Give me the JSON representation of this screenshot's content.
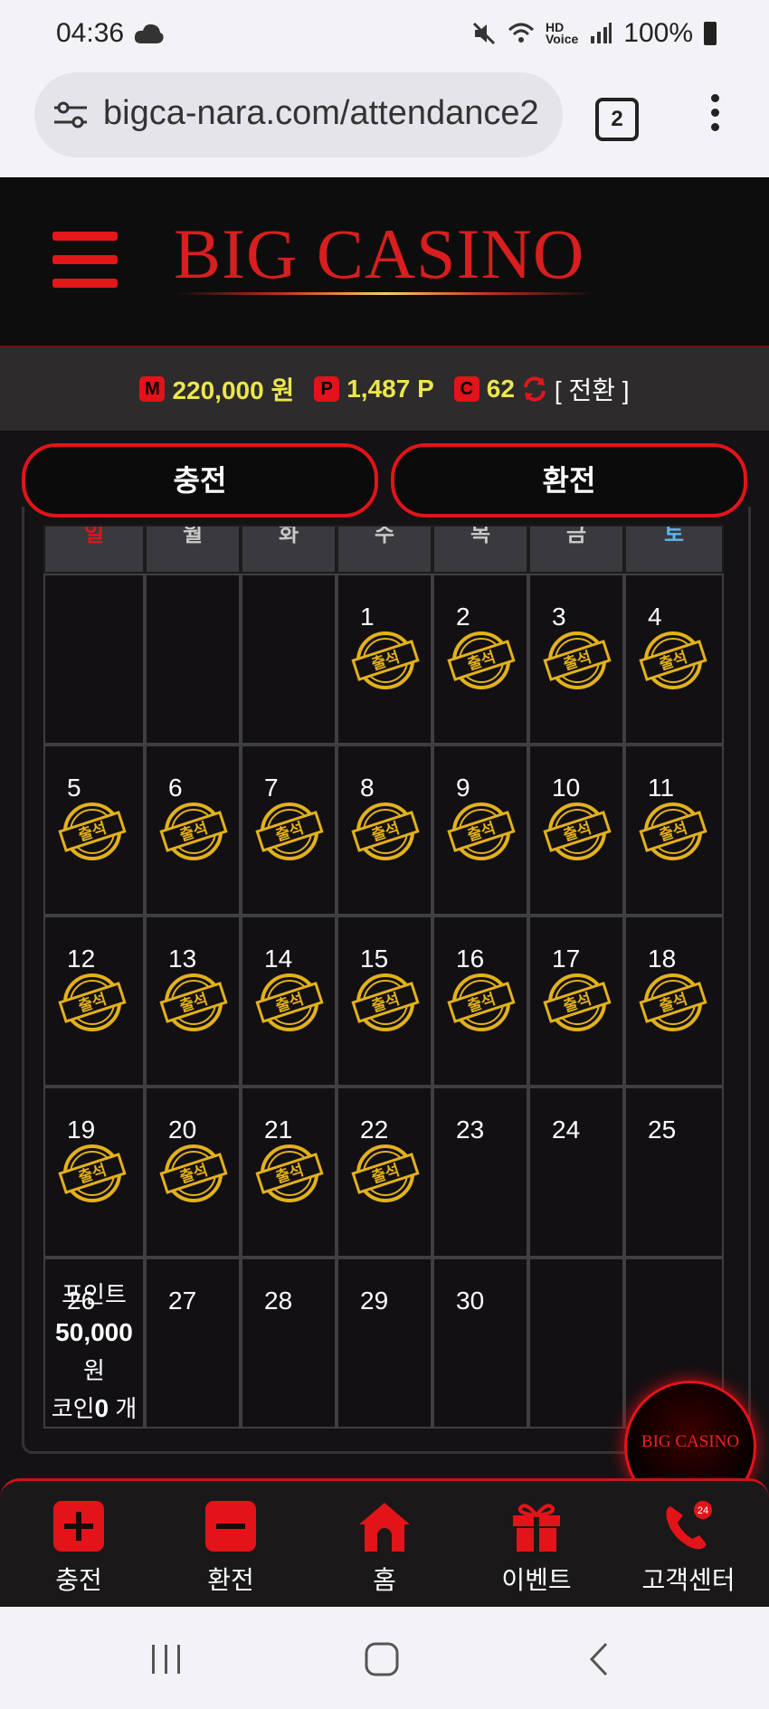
{
  "status": {
    "time": "04:36",
    "battery": "100%"
  },
  "browser": {
    "url": "bigca-nara.com/attendance2",
    "tab_count": "2"
  },
  "header": {
    "logo": "BIG CASINO"
  },
  "balance": {
    "money_badge": "M",
    "money": "220,000 원",
    "points_badge": "P",
    "points": "1,487 P",
    "coins_badge": "C",
    "coins": "62",
    "convert": "[ 전환 ]"
  },
  "actions": {
    "charge": "충전",
    "exchange": "환전"
  },
  "calendar": {
    "weekdays": [
      "일",
      "월",
      "화",
      "수",
      "목",
      "금",
      "토"
    ],
    "stamp_label": "출석",
    "weeks": [
      [
        null,
        null,
        null,
        1,
        2,
        3,
        4
      ],
      [
        5,
        6,
        7,
        8,
        9,
        10,
        11
      ],
      [
        12,
        13,
        14,
        15,
        16,
        17,
        18
      ],
      [
        19,
        20,
        21,
        22,
        23,
        24,
        25
      ],
      [
        26,
        27,
        28,
        29,
        30,
        null,
        null
      ]
    ],
    "attended_through": 22,
    "reward": {
      "day": 26,
      "points_label": "포인트",
      "points_value": "50,000",
      "points_unit": "원",
      "coin_label": "코인",
      "coin_value": "0",
      "coin_unit": "개"
    }
  },
  "fab": {
    "label": "BIG CASINO"
  },
  "bottom_nav": [
    {
      "label": "충전",
      "icon": "plus-icon"
    },
    {
      "label": "환전",
      "icon": "minus-icon"
    },
    {
      "label": "홈",
      "icon": "home-icon"
    },
    {
      "label": "이벤트",
      "icon": "gift-icon"
    },
    {
      "label": "고객센터",
      "icon": "phone-24-icon"
    }
  ]
}
